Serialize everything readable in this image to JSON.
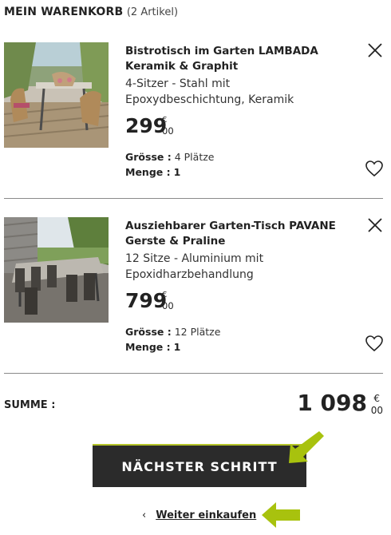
{
  "cart": {
    "title": "MEIN WARENKORB",
    "count": "(2 Artikel)"
  },
  "items": [
    {
      "name": "Bistrotisch im Garten LAMBADA Keramik & Graphit",
      "description": "4-Sitzer - Stahl mit Epoxydbeschichtung, Keramik",
      "price_int": "299",
      "price_currency": "€",
      "price_cents": "00",
      "size_label": "Grösse :",
      "size_value": "4 Plätze",
      "qty_label": "Menge :",
      "qty_value": "1",
      "image_icon": "garden-bistro-table-photo"
    },
    {
      "name": "Ausziehbarer Garten-Tisch PAVANE Gerste & Praline",
      "description": "12 Sitze - Aluminium mit Epoxidharzbehandlung",
      "price_int": "799",
      "price_currency": "€",
      "price_cents": "00",
      "size_label": "Grösse :",
      "size_value": "12 Plätze",
      "qty_label": "Menge :",
      "qty_value": "1",
      "image_icon": "extendable-garden-table-photo"
    }
  ],
  "summary": {
    "label": "SUMME :",
    "total_int": "1 098",
    "total_currency": "€",
    "total_cents": "00"
  },
  "actions": {
    "next_label": "NÄCHSTER SCHRITT",
    "continue_chevron": "‹",
    "continue_label": "Weiter einkaufen"
  },
  "colors": {
    "button_bg": "#2b2b2b",
    "accent_arrow": "#a8c20e",
    "divider": "#8a8a8a"
  }
}
